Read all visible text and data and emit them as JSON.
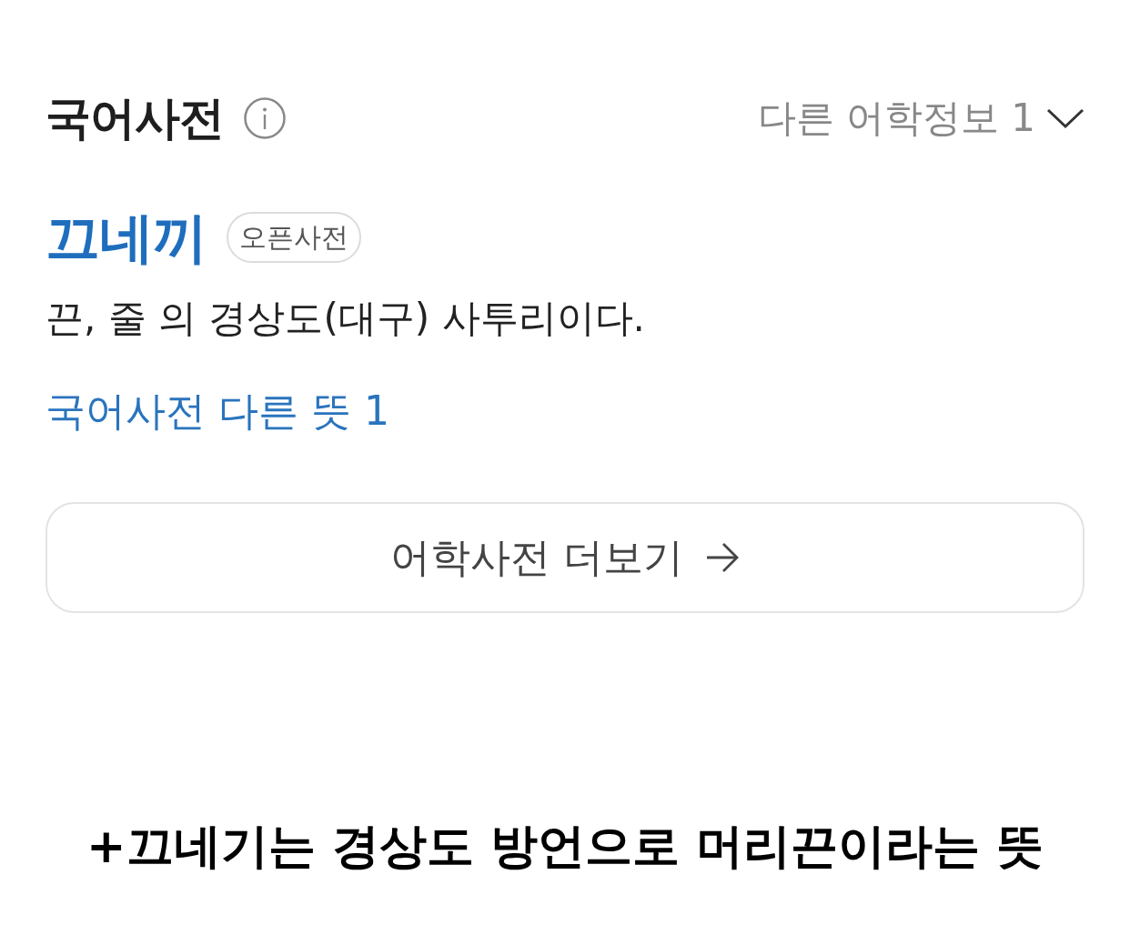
{
  "header": {
    "title": "국어사전",
    "other_info": {
      "label": "다른 어학정보 1"
    }
  },
  "entry": {
    "headword": "끄네끼",
    "badge": "오픈사전",
    "definition": "끈, 줄 의 경상도(대구) 사투리이다.",
    "other_meanings_link": "국어사전 다른 뜻 1"
  },
  "more_button": {
    "label": "어학사전 더보기"
  },
  "caption": "+끄네기는 경상도 방언으로 머리끈이라는 뜻"
}
